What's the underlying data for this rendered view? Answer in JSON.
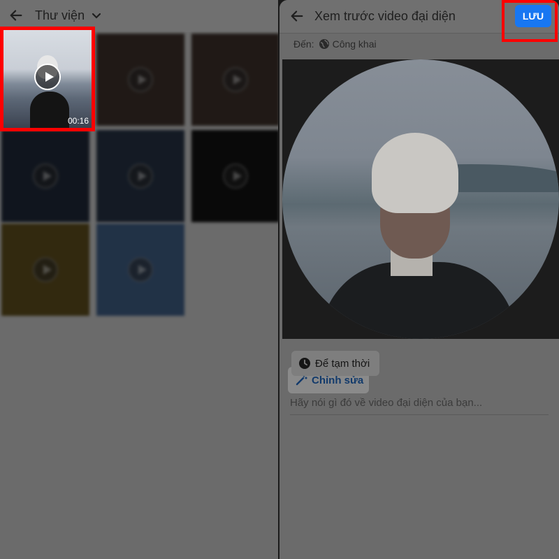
{
  "library": {
    "title": "Thư viện",
    "selected_duration": "00:16"
  },
  "preview": {
    "title": "Xem trước video đại diện",
    "save_label": "LƯU",
    "audience_label": "Đến:",
    "audience_value": "Công khai",
    "edit_label": "Chỉnh sửa",
    "temporary_label": "Để tạm thời",
    "caption_placeholder": "Hãy nói gì đó về video đại diện của bạn..."
  },
  "colors": {
    "accent": "#1877f2",
    "highlight": "#ff0000"
  },
  "icons": {
    "back": "arrow-left-icon",
    "chevron": "chevron-down-icon",
    "play": "play-icon",
    "globe": "globe-icon",
    "wand": "magic-wand-icon",
    "clock": "clock-icon"
  }
}
